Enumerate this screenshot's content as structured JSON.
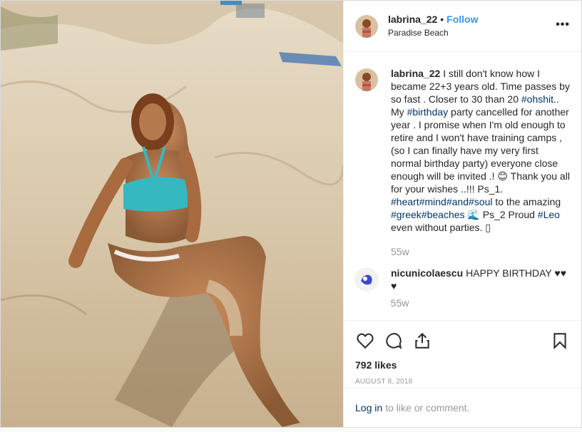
{
  "header": {
    "username": "labrina_22",
    "separator": "•",
    "follow_label": "Follow",
    "location": "Paradise Beach",
    "more_label": "•••"
  },
  "caption": {
    "username": "labrina_22",
    "segments": [
      {
        "text": "I still don't know how I became 22+3 years old. Time passes by so fast . Closer to 30 than 20 ",
        "tag": false
      },
      {
        "text": "#ohshit",
        "tag": true
      },
      {
        "text": ".. My ",
        "tag": false
      },
      {
        "text": "#birthday",
        "tag": true
      },
      {
        "text": " party cancelled for another year . I promise when I'm old enough to retire and I won't have training camps , (so I can finally have my very first normal birthday party) everyone close enough will be invited .! 😊 Thank you all for your wishes ..!!! Ps_1. ",
        "tag": false
      },
      {
        "text": "#heart",
        "tag": true
      },
      {
        "text": "#mind",
        "tag": true
      },
      {
        "text": "#and",
        "tag": true
      },
      {
        "text": "#soul",
        "tag": true
      },
      {
        "text": " to the amazing ",
        "tag": false
      },
      {
        "text": "#greek",
        "tag": true
      },
      {
        "text": "#beaches",
        "tag": true
      },
      {
        "text": " 🌊 Ps_2 Proud ",
        "tag": false
      },
      {
        "text": "#Leo",
        "tag": true
      },
      {
        "text": " even without parties. ▯",
        "tag": false
      }
    ],
    "time_ago": "55w"
  },
  "comments": [
    {
      "username": "nicunicolaescu",
      "text": "HAPPY BIRTHDAY ♥♥ ♥"
    },
    {
      "username": "",
      "text": "55w"
    }
  ],
  "actions": {
    "likes": "792 likes",
    "date": "AUGUST 8, 2018"
  },
  "login": {
    "link": "Log in",
    "text": "to like or comment."
  },
  "colors": {
    "link": "#3897f0",
    "hashtag": "#003569",
    "muted": "#999999",
    "border": "#dbdbdb"
  },
  "icons": [
    "heart-icon",
    "comment-icon",
    "share-icon",
    "bookmark-icon",
    "more-options-icon"
  ]
}
